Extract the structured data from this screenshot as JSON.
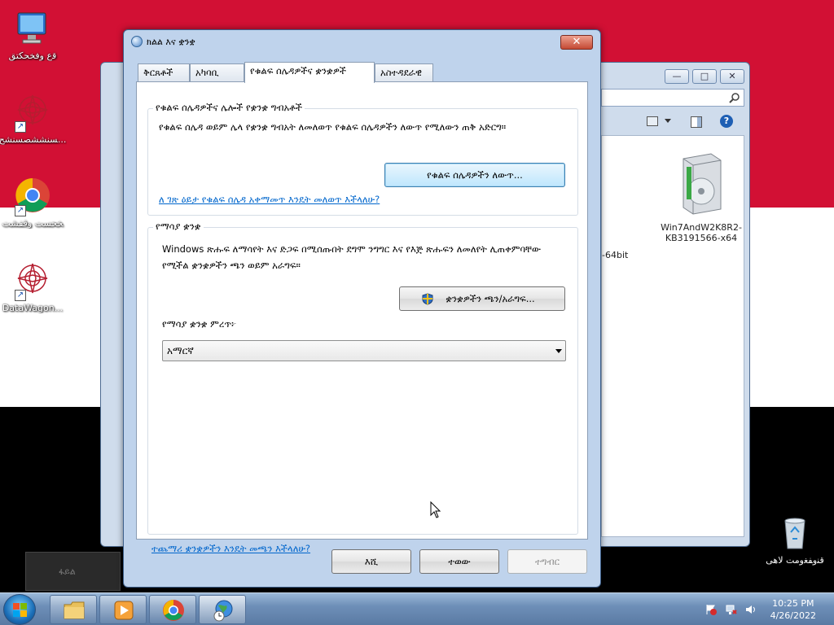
{
  "desktop": {
    "icons": [
      {
        "label": "ﻗﻉ ﻭﻓﺨﺤﻜﺘﻖ"
      },
      {
        "label": "ﺴﻨﺸﺸﺼﺴﻨﺸﺢ..."
      },
      {
        "label": "ﺨﺤﺴﺖ ﻭﻗﻔﺸﺖ"
      },
      {
        "label": "DataWagon..."
      },
      {
        "label": "ﻗﻨﻭﻔﻐﻭﻣﺖ ﻻﻫﻰ"
      }
    ]
  },
  "explorer": {
    "files": [
      {
        "label": "-64bit"
      },
      {
        "label": "Win7AndW2K8R2-KB3191566-x64"
      }
    ],
    "ghost_taskbar_label": "ፋይል"
  },
  "dialog": {
    "title": "ክልል እና ቋንቋ",
    "close_label": "✕",
    "tabs": [
      {
        "label": "ቅርጸቶች"
      },
      {
        "label": "አካባቢ"
      },
      {
        "label": "የቁልፍ ሰሌዳዎችና ቋንቋዎች"
      },
      {
        "label": "አስተዳደራዊ"
      }
    ],
    "keyboards_group": {
      "title": "የቁልፍ ሰሌዳዎችና ሌሎች የቋንቋ ግብአቶች",
      "description": "የቁልፍ ሰሌዳ ወይም ሌላ የቋንቋ ግብአት ለመለወጥ የቁልፍ ሰሌዳዎችን ለውጥ የሚለውን ጠቅ አድርግ።",
      "change_button": "የቁልፍ ሰሌዳዎችን ለውጥ...",
      "help_link": "ለ ገጽ ዕይታ የቁልፍ ሰሌዳ አቀማመጥ እንዴት መለወጥ እችላለሁ?"
    },
    "display_group": {
      "title": "የማሳያ ቋንቋ",
      "description": "Windows ጽሑፍ ለማሳየት እና ድጋፍ በሚሰጡበት ደግሞ ንግግር እና የእጅ ጽሑፍን ለመለየት ሊጠቀምባቸው የሚችል ቋንቋዎችን ጫን ወይም አራግፍ።",
      "install_button": "ቋንቋዎችን ጫን/አራግፍ...",
      "choose_label": "የማሳያ ቋንቋ ምረጥ፦",
      "selected_language": "አማርኛ"
    },
    "more_link": "ተጨማሪ ቋንቋዎችን እንዴት መጫን እችላለሁ?",
    "ok_button": "እሺ",
    "cancel_button": "ተወው",
    "apply_button": "ተግብር"
  },
  "taskbar": {
    "time": "10:25 PM",
    "date": "4/26/2022"
  }
}
